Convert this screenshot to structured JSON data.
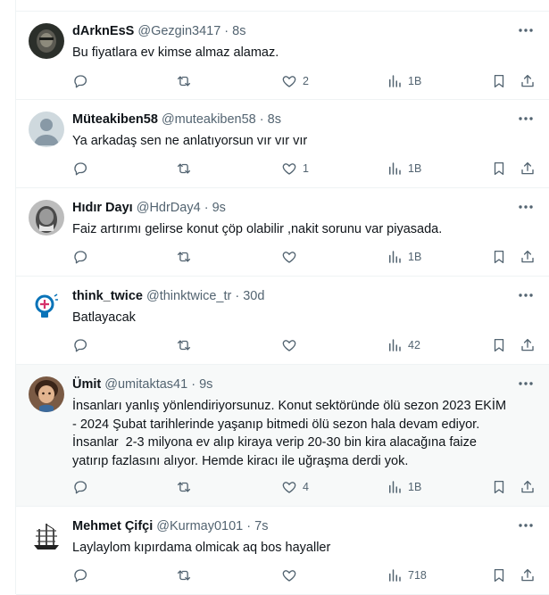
{
  "tweets": [
    {
      "name": "dArknEsS",
      "handle": "@Gezgin3417",
      "time": "8s",
      "text": "Bu fiyatlara ev kimse almaz alamaz.",
      "likes": "2",
      "views": "1B",
      "avatar": "dark-portrait"
    },
    {
      "name": "Müteakiben58",
      "handle": "@muteakiben58",
      "time": "8s",
      "text": "Ya arkadaş sen ne anlatıyorsun vır vır vır",
      "likes": "1",
      "views": "1B",
      "avatar": "default-avatar"
    },
    {
      "name": "Hıdır Dayı",
      "handle": "@HdrDay4",
      "time": "9s",
      "text": "Faiz artırımı gelirse konut çöp olabilir ,nakit sorunu var piyasada.",
      "likes": "",
      "views": "1B",
      "avatar": "bw-portrait"
    },
    {
      "name": "think_twice",
      "handle": "@thinktwice_tr",
      "time": "30d",
      "text": "Batlayacak",
      "likes": "",
      "views": "42",
      "avatar": "lightbulb-logo"
    },
    {
      "name": "Ümit",
      "handle": "@umitaktas41",
      "time": "9s",
      "text": "İnsanları yanlış yönlendiriyorsunuz. Konut sektöründe ölü sezon 2023 EKİM\n- 2024 Şubat tarihlerinde yaşanıp bitmedi ölü sezon hala devam ediyor.\nİnsanlar  2-3 milyona ev alıp kiraya verip 20-30 bin kira alacağına faize\nyatırıp fazlasını alıyor. Hemde kiracı ile uğraşma derdi yok.",
      "likes": "4",
      "views": "1B",
      "avatar": "child-portrait"
    },
    {
      "name": "Mehmet Çifçi",
      "handle": "@Kurmay0101",
      "time": "7s",
      "text": "Laylaylom kıpırdama olmicak aq bos hayaller",
      "likes": "",
      "views": "718",
      "avatar": "ship-sketch"
    }
  ],
  "separator": "·",
  "colors": {
    "text": "#0f1419",
    "muted": "#536471",
    "border": "#eff3f4",
    "highlight_bg": "#f7f9f9"
  }
}
